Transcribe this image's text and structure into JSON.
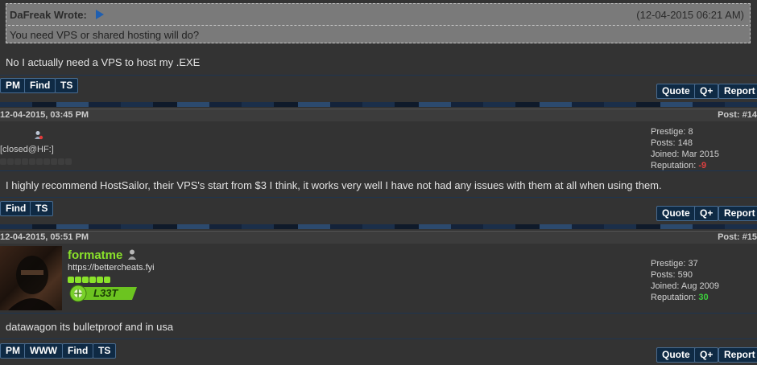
{
  "quote": {
    "author": "DaFreak Wrote:",
    "date": "(12-04-2015 06:21 AM)",
    "text": "You need VPS or shared hosting will do?"
  },
  "post1": {
    "message": "No I actually need a VPS to host my .EXE",
    "left_buttons": [
      "PM",
      "Find",
      "TS"
    ],
    "right_buttons": [
      "Quote",
      "Q+",
      "Report"
    ]
  },
  "post2": {
    "date": "12-04-2015, 03:45 PM",
    "number": "Post: #14",
    "usertitle": "[closed@HF:]",
    "stats": {
      "prestige": "Prestige: 8",
      "posts": "Posts: 148",
      "joined": "Joined: Mar 2015",
      "reputation_label": "Reputation: ",
      "reputation_value": "-9"
    },
    "message": "I highly recommend HostSailor, their VPS's start from $3 I think, it works very well I have not had any issues with them at all when using them.",
    "left_buttons": [
      "Find",
      "TS"
    ],
    "right_buttons": [
      "Quote",
      "Q+",
      "Report"
    ]
  },
  "post3": {
    "date": "12-04-2015, 05:51 PM",
    "number": "Post: #15",
    "username": "formatme",
    "usertitle": "https://bettercheats.fyi",
    "badge": "L33T",
    "stats": {
      "prestige": "Prestige: 37",
      "posts": "Posts: 590",
      "joined": "Joined: Aug 2009",
      "reputation_label": "Reputation: ",
      "reputation_value": "30"
    },
    "message": "datawagon its bulletproof and in usa",
    "left_buttons": [
      "PM",
      "WWW",
      "Find",
      "TS"
    ],
    "right_buttons": [
      "Quote",
      "Q+",
      "Report"
    ]
  },
  "colors": {
    "username_green": "#8ae22a",
    "rep_negative": "#e04040",
    "rep_positive": "#3cd03c",
    "button_bg": "#0f2a44"
  },
  "icons": [
    "play-arrow-icon",
    "user-offline-icon",
    "user-icon",
    "avatar-image",
    "l33t-badge-icon"
  ]
}
